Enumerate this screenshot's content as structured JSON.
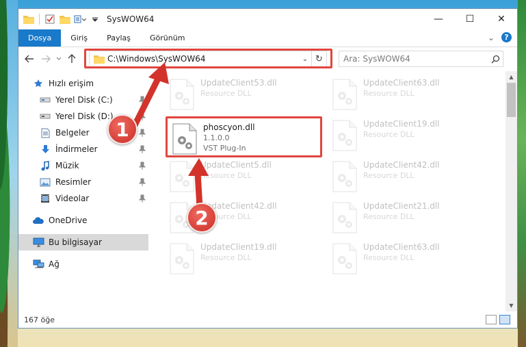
{
  "window": {
    "title": "SysWOW64",
    "controls": {
      "minimize": "—",
      "maximize": "☐",
      "close": "✕"
    }
  },
  "ribbon": {
    "tabs": [
      {
        "label": "Dosya",
        "active": true
      },
      {
        "label": "Giriş"
      },
      {
        "label": "Paylaş"
      },
      {
        "label": "Görünüm"
      }
    ],
    "help": "?",
    "collapse": "⌄"
  },
  "address": {
    "path": "C:\\Windows\\SysWOW64",
    "dropdown": "⌄",
    "refresh": "↻"
  },
  "search": {
    "placeholder": "Ara: SysWOW64"
  },
  "sidebar": {
    "quick_access": "Hızlı erişim",
    "items": [
      {
        "label": "Yerel Disk (C:)",
        "icon": "drive-icon",
        "pinned": true
      },
      {
        "label": "Yerel Disk (D:)",
        "icon": "drive-icon",
        "pinned": true
      },
      {
        "label": "Belgeler",
        "icon": "documents-icon",
        "pinned": true
      },
      {
        "label": "İndirmeler",
        "icon": "download-icon",
        "pinned": true
      },
      {
        "label": "Müzik",
        "icon": "music-icon",
        "pinned": true
      },
      {
        "label": "Resimler",
        "icon": "pictures-icon",
        "pinned": true
      },
      {
        "label": "Videolar",
        "icon": "videos-icon",
        "pinned": true
      }
    ],
    "onedrive": "OneDrive",
    "this_pc": "Bu bilgisayar",
    "network": "Ağ"
  },
  "files": {
    "left": [
      {
        "name": "UpdateClient53.dll",
        "type": "Resource DLL"
      },
      {
        "name": "phoscyon.dll",
        "version": "1.1.0.0",
        "type": "VST Plug-In"
      },
      {
        "name": "UpdateClient5.dll",
        "type": "Resource DLL"
      },
      {
        "name": "UpdateClient42.dll",
        "type": "Resource DLL"
      },
      {
        "name": "UpdateClient19.dll",
        "type": "Resource DLL"
      }
    ],
    "right": [
      {
        "name": "UpdateClient63.dll",
        "type": "Resource DLL"
      },
      {
        "name": "UpdateClient19.dll",
        "type": "Resource DLL"
      },
      {
        "name": "UpdateClient42.dll",
        "type": "Resource DLL"
      },
      {
        "name": "UpdateClient21.dll",
        "type": "Resource DLL"
      },
      {
        "name": "UpdateClient63.dll",
        "type": "Resource DLL"
      }
    ]
  },
  "markers": {
    "step1": "1",
    "step2": "2"
  },
  "status": {
    "count": "167 öğe"
  },
  "colors": {
    "accent": "#1979ca",
    "highlight": "#e0463f",
    "selected": "#d9d9d9"
  }
}
